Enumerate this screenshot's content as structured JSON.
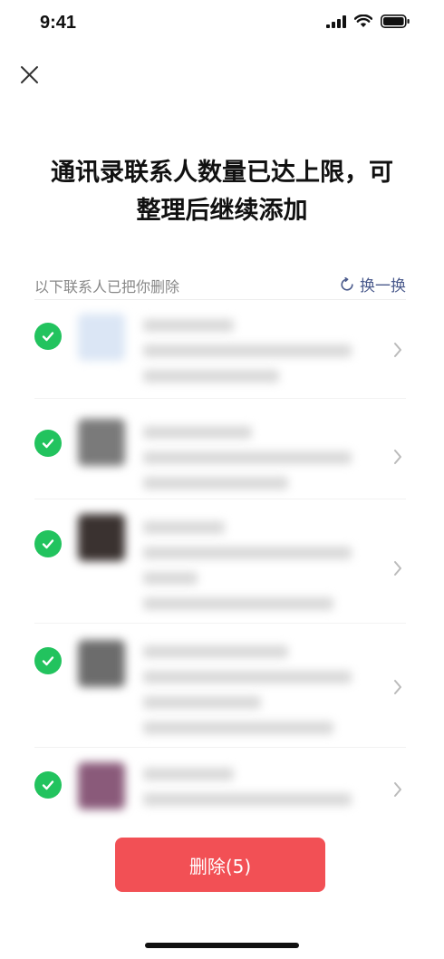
{
  "status_bar": {
    "time": "9:41"
  },
  "header": {
    "title_line1": "通讯录联系人数量已达上限，可",
    "title_line2": "整理后继续添加"
  },
  "list": {
    "caption": "以下联系人已把你删除",
    "swap_label": "换一换",
    "contacts": [
      {
        "selected": true
      },
      {
        "selected": true
      },
      {
        "selected": true
      },
      {
        "selected": true
      },
      {
        "selected": true
      }
    ]
  },
  "footer": {
    "delete_label": "删除(5)"
  },
  "colors": {
    "accent_green": "#22c35e",
    "delete_red": "#f25055",
    "link_blue": "#4a5a8c"
  },
  "icons": [
    "close-icon",
    "refresh-icon",
    "check-icon",
    "chevron-right-icon",
    "signal-icon",
    "wifi-icon",
    "battery-icon"
  ]
}
